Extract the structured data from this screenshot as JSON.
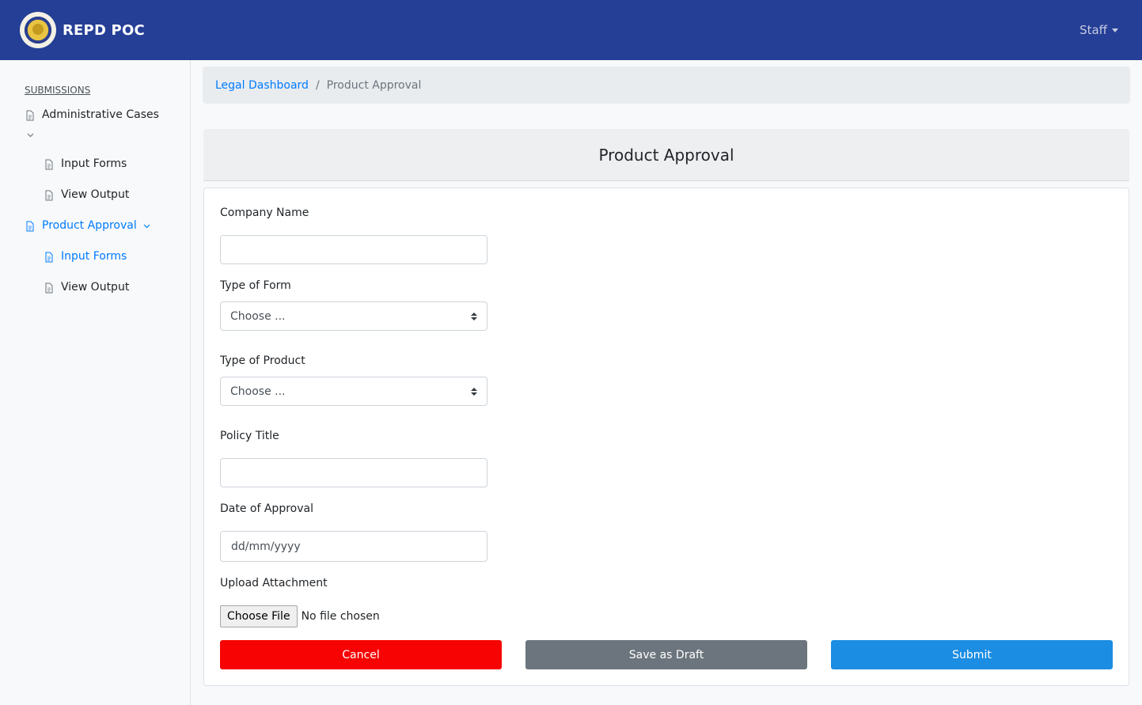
{
  "navbar": {
    "brand": "REPD POC",
    "user_menu": "Staff"
  },
  "sidebar": {
    "heading": "SUBMISSIONS",
    "items": [
      {
        "label": "Administrative Cases"
      },
      {
        "label": "Input Forms"
      },
      {
        "label": "View Output"
      },
      {
        "label": "Product Approval"
      },
      {
        "label": "Input Forms"
      },
      {
        "label": "View Output"
      }
    ]
  },
  "breadcrumb": {
    "parent": "Legal Dashboard",
    "separator": "/",
    "current": "Product Approval"
  },
  "form": {
    "title": "Product Approval",
    "company_name": {
      "label": "Company Name",
      "value": ""
    },
    "type_of_form": {
      "label": "Type of Form",
      "selected": "Choose ..."
    },
    "type_of_product": {
      "label": "Type of Product",
      "selected": "Choose ..."
    },
    "policy_title": {
      "label": "Policy Title",
      "value": ""
    },
    "date_of_approval": {
      "label": "Date of Approval",
      "placeholder": "dd/mm/yyyy"
    },
    "upload": {
      "label": "Upload Attachment",
      "button": "Choose File",
      "status": "No file chosen"
    },
    "buttons": {
      "cancel": "Cancel",
      "draft": "Save as Draft",
      "submit": "Submit"
    }
  },
  "colors": {
    "navbar": "#253f96",
    "link": "#007bff",
    "cancel": "#f70303",
    "draft": "#6c757d",
    "submit": "#1b8de3"
  }
}
